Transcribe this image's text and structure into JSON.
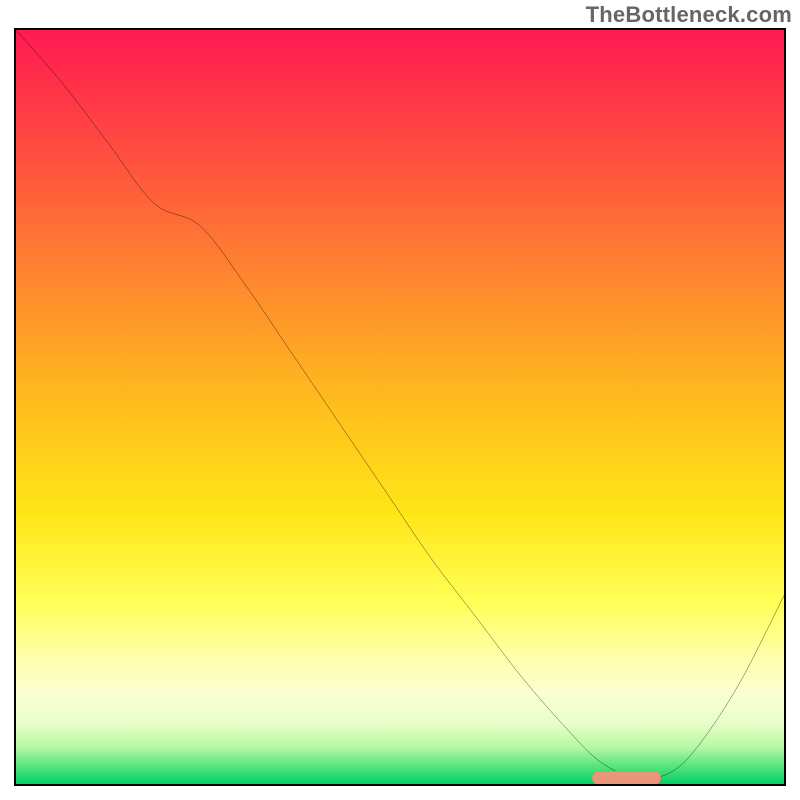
{
  "watermark": "TheBottleneck.com",
  "chart_data": {
    "type": "line",
    "title": "",
    "xlabel": "",
    "ylabel": "",
    "xlim": [
      0,
      100
    ],
    "ylim": [
      0,
      100
    ],
    "grid": false,
    "legend": false,
    "annotations": [],
    "series": [
      {
        "name": "bottleneck-curve",
        "x": [
          0,
          6,
          12,
          18,
          24,
          30,
          36,
          42,
          48,
          54,
          60,
          66,
          72,
          76,
          80,
          84,
          88,
          94,
          100
        ],
        "y": [
          100,
          93,
          85,
          77,
          74,
          66,
          57,
          48,
          39,
          30,
          22,
          14,
          7,
          3,
          1,
          1,
          4,
          13,
          25
        ]
      }
    ],
    "marker": {
      "name": "optimal-range",
      "x_start": 75,
      "x_end": 84,
      "y": 0.8,
      "color": "#e9967a"
    },
    "gradient_stops": [
      {
        "pct": 0,
        "color": "#ff1a52"
      },
      {
        "pct": 8,
        "color": "#ff3348"
      },
      {
        "pct": 20,
        "color": "#ff5a3c"
      },
      {
        "pct": 34,
        "color": "#ff8a2e"
      },
      {
        "pct": 48,
        "color": "#ffb81f"
      },
      {
        "pct": 64,
        "color": "#ffe617"
      },
      {
        "pct": 76,
        "color": "#ffff58"
      },
      {
        "pct": 83,
        "color": "#ffffa8"
      },
      {
        "pct": 88,
        "color": "#fbffd2"
      },
      {
        "pct": 92,
        "color": "#e8ffc8"
      },
      {
        "pct": 95,
        "color": "#b8f9a6"
      },
      {
        "pct": 98,
        "color": "#4be27a"
      },
      {
        "pct": 100,
        "color": "#00d066"
      }
    ]
  }
}
